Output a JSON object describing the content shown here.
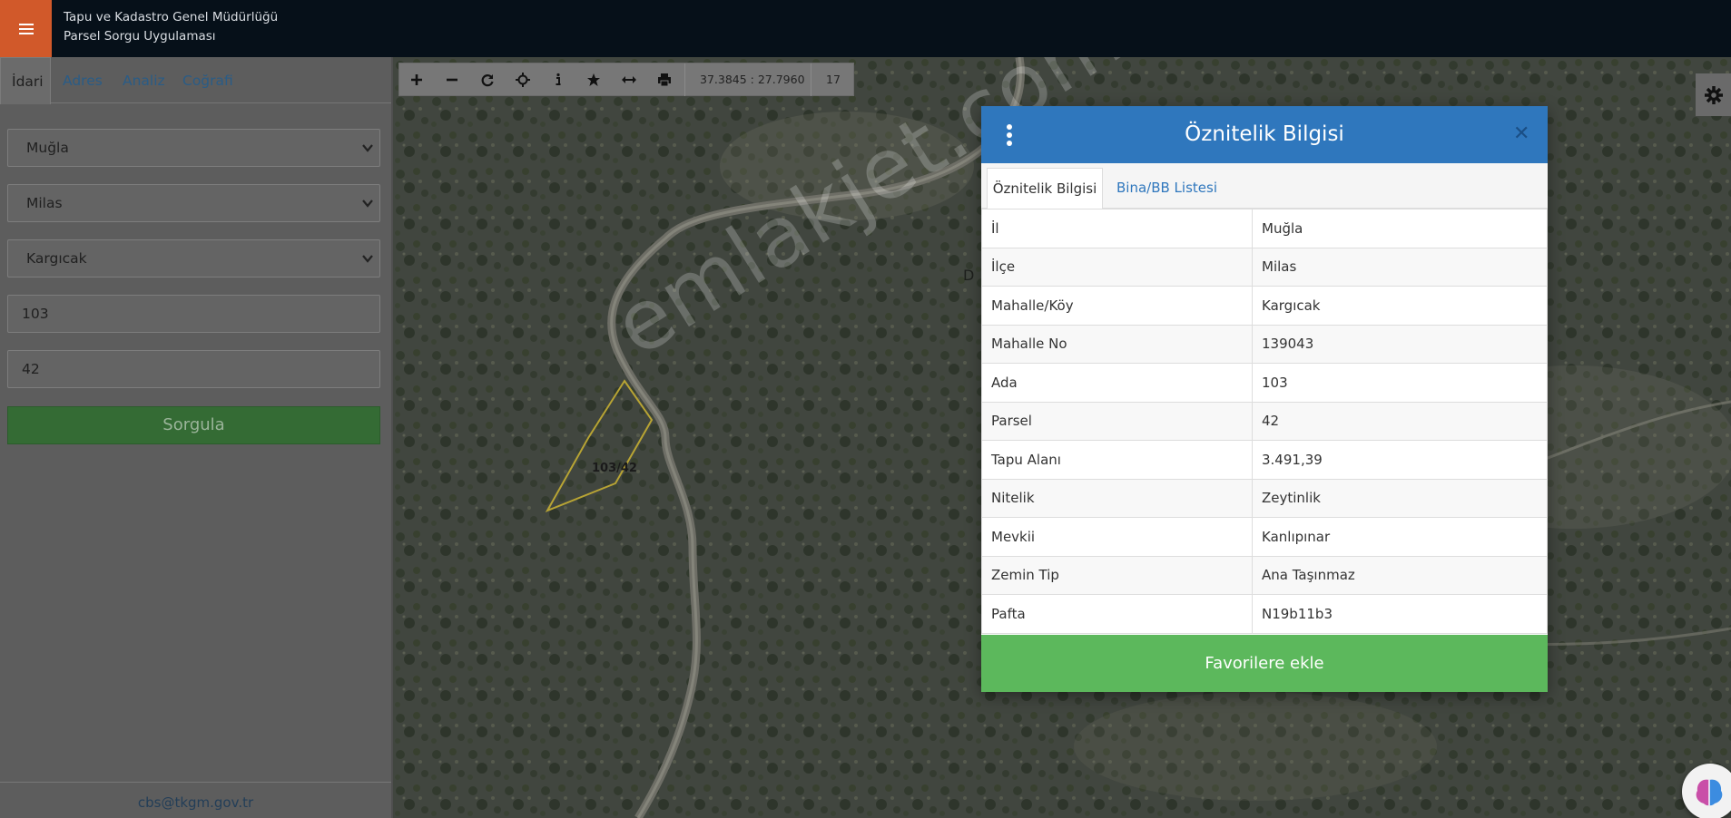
{
  "header": {
    "title_line1": "Tapu ve Kadastro Genel Müdürlüğü",
    "title_line2": "Parsel Sorgu Uygulaması"
  },
  "sidebar": {
    "tabs": [
      "İdari",
      "Adres",
      "Analiz",
      "Coğrafi"
    ],
    "il": "Muğla",
    "ilce": "Milas",
    "mahalle": "Kargıcak",
    "ada": "103",
    "parsel": "42",
    "submit_label": "Sorgula",
    "footer_email": "cbs@tkgm.gov.tr"
  },
  "toolbar": {
    "coordinates": "37.3845 : 27.7960",
    "zoom": "17",
    "icons": [
      "zoom-in-icon",
      "zoom-out-icon",
      "refresh-icon",
      "locate-icon",
      "info-icon",
      "favorite-star-icon",
      "measure-icon",
      "print-icon"
    ]
  },
  "map": {
    "parcel_label": "103/42",
    "road_label": "D",
    "watermark": "emlakjet.com",
    "parcel_outline_color": "#b8a434"
  },
  "modal": {
    "title": "Öznitelik Bilgisi",
    "tabs": [
      "Öznitelik Bilgisi",
      "Bina/BB Listesi"
    ],
    "rows": [
      {
        "key": "İl",
        "value": "Muğla"
      },
      {
        "key": "İlçe",
        "value": "Milas"
      },
      {
        "key": "Mahalle/Köy",
        "value": "Kargıcak"
      },
      {
        "key": "Mahalle No",
        "value": "139043"
      },
      {
        "key": "Ada",
        "value": "103"
      },
      {
        "key": "Parsel",
        "value": "42"
      },
      {
        "key": "Tapu Alanı",
        "value": "3.491,39"
      },
      {
        "key": "Nitelik",
        "value": "Zeytinlik"
      },
      {
        "key": "Mevkii",
        "value": "Kanlıpınar"
      },
      {
        "key": "Zemin Tip",
        "value": "Ana Taşınmaz"
      },
      {
        "key": "Pafta",
        "value": "N19b11b3"
      }
    ],
    "favorite_label": "Favorilere ekle",
    "header_color": "#2f77bd",
    "favorite_color": "#5cb85c"
  }
}
